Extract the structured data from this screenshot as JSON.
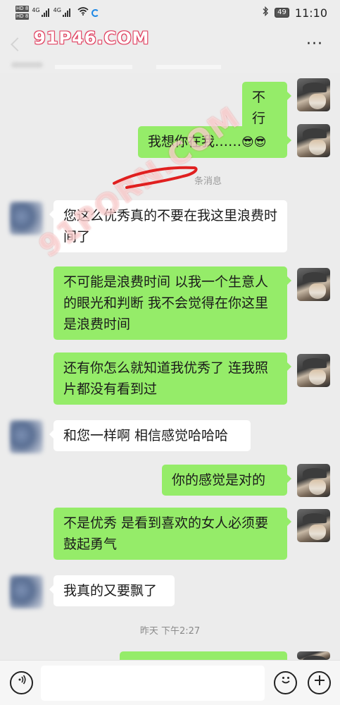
{
  "status_bar": {
    "sim1": "HD 8",
    "sim2": "HD 8",
    "net1": "4G",
    "net2": "4G",
    "battery": "49",
    "time": "11:10"
  },
  "header": {
    "more_label": "···"
  },
  "watermarks": {
    "top": "91P46.COM",
    "diagonal": "91PORN.COM"
  },
  "system_notice": "条消息",
  "messages": [
    {
      "from": "me",
      "text": "不行"
    },
    {
      "from": "me",
      "text": "我想你在我……",
      "emoji": [
        "😎",
        "😎"
      ]
    },
    {
      "from": "them",
      "text": "您这么优秀真的不要在我这里浪费时间了"
    },
    {
      "from": "me",
      "text": "不可能是浪费时间 以我一个生意人的眼光和判断 我不会觉得在你这里是浪费时间"
    },
    {
      "from": "me",
      "text": "还有你怎么就知道我优秀了 连我照片都没有看到过"
    },
    {
      "from": "them",
      "text": "和您一样啊 相信感觉哈哈哈"
    },
    {
      "from": "me",
      "text": "你的感觉是对的"
    },
    {
      "from": "me",
      "text": "不是优秀 是看到喜欢的女人必须要鼓起勇气"
    },
    {
      "from": "them",
      "text": "我真的又要飘了"
    }
  ],
  "timestamp": "昨天 下午2:27",
  "input_bar": {
    "voice_icon": "voice-icon",
    "emoji_icon": "emoji-icon",
    "plus_icon": "plus-icon",
    "placeholder": ""
  },
  "colors": {
    "my_bubble": "#95ec69",
    "their_bubble": "#ffffff",
    "background": "#ececec"
  }
}
